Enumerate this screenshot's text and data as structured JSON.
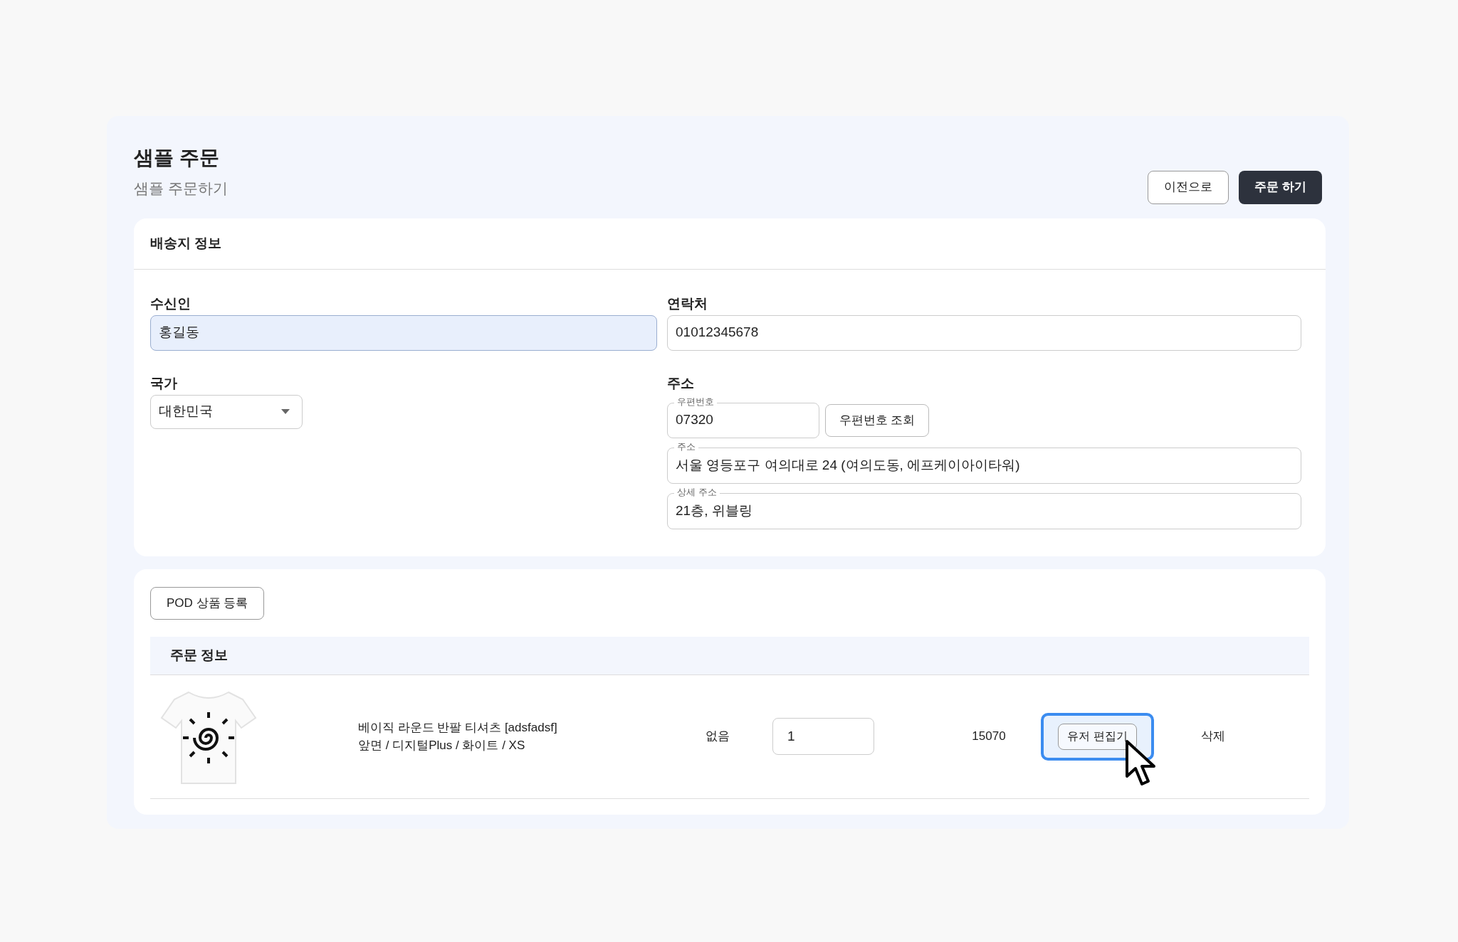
{
  "header": {
    "title": "샘플 주문",
    "subtitle": "샘플 주문하기",
    "buttons": [
      {
        "label": "이전으로",
        "kind": "outline"
      },
      {
        "label": "주문 하기",
        "kind": "primary"
      }
    ]
  },
  "shipping": {
    "title": "배송지 정보",
    "recipient": {
      "label": "수신인",
      "value": "홍길동",
      "focused": true
    },
    "phone": {
      "label": "연락처",
      "value": "01012345678"
    },
    "country": {
      "label": "국가",
      "value": "대한민국"
    },
    "address": {
      "label": "주소",
      "postal": {
        "label": "우편번호",
        "value": "07320"
      },
      "postal_button": "우편번호 조회",
      "address": {
        "label": "주소",
        "value": "서울 영등포구 여의대로 24 (여의도동, 에프케이아이타워)"
      },
      "detail": {
        "label": "상세 주소",
        "value": "21층, 위블링"
      }
    }
  },
  "order": {
    "register_button": "POD 상품 등록",
    "title": "주문 정보",
    "rows": [
      {
        "name": "베이직 라운드 반팔 티셔츠 [adsfadsf]",
        "options": "앞면 / 디지털Plus / 화이트 / XS",
        "column_3": "없음",
        "quantity": "1",
        "price": "15070",
        "editor_button": "유저 편집기",
        "highlighted": true,
        "delete": "삭제"
      }
    ]
  }
}
